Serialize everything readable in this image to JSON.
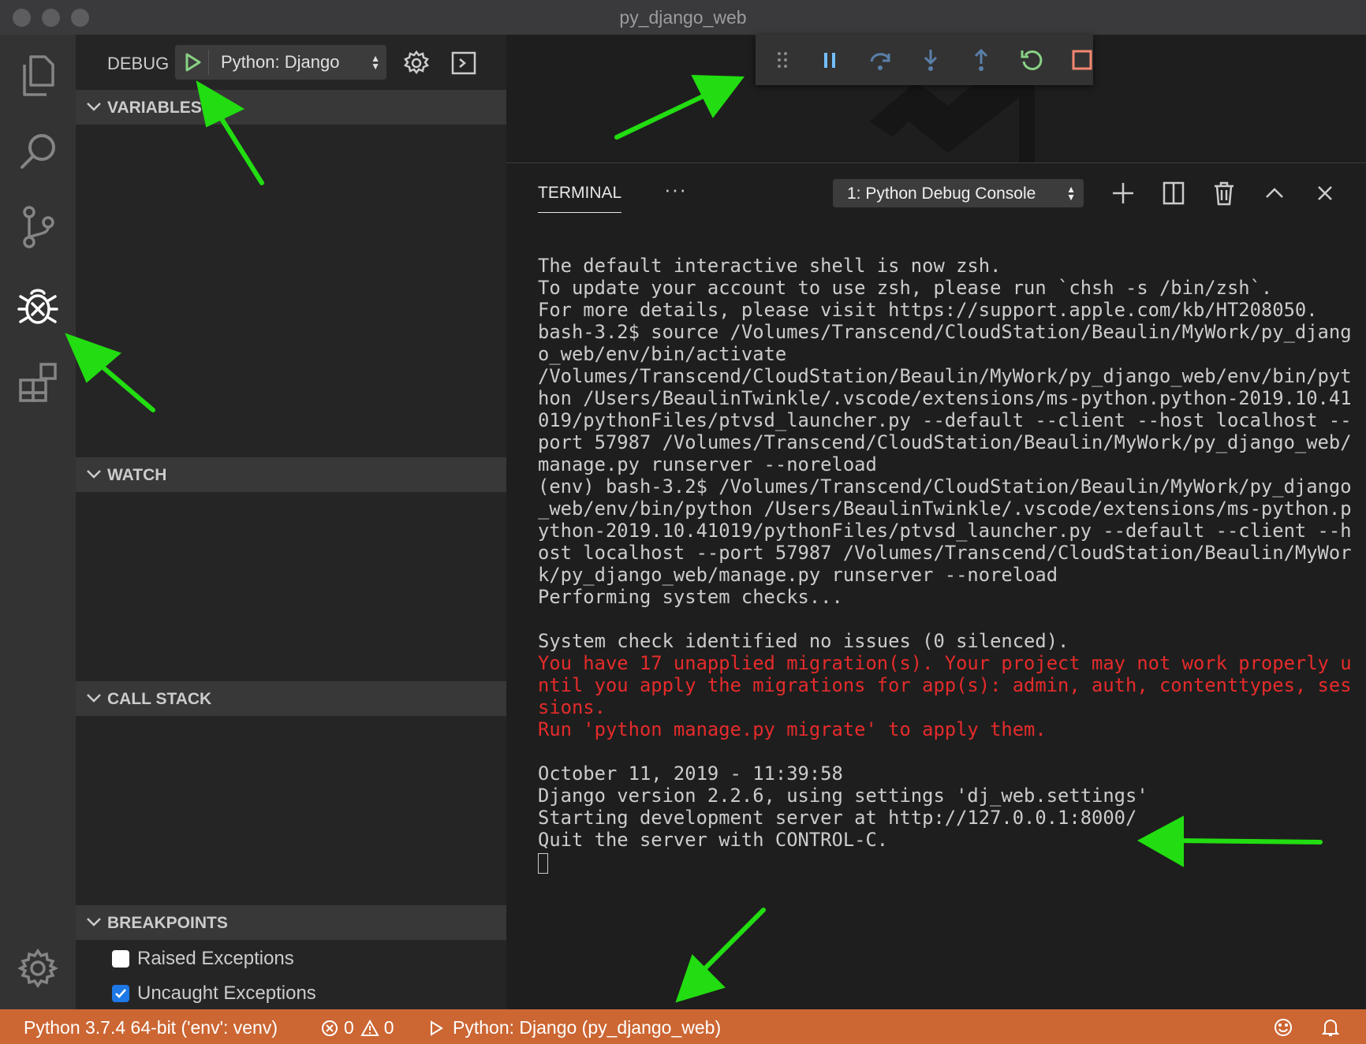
{
  "window": {
    "title": "py_django_web"
  },
  "activity_bar": {
    "items": [
      {
        "name": "explorer-icon"
      },
      {
        "name": "search-icon"
      },
      {
        "name": "source-control-icon"
      },
      {
        "name": "debug-icon",
        "active": true
      },
      {
        "name": "extensions-icon"
      }
    ],
    "bottom": {
      "name": "gear-icon"
    }
  },
  "debug_toolbar": {
    "label": "DEBUG",
    "configuration": "Python: Django",
    "icons": [
      "start-debugging-icon",
      "settings-gear-icon",
      "debug-console-icon"
    ]
  },
  "sections": [
    {
      "title": "VARIABLES"
    },
    {
      "title": "WATCH"
    },
    {
      "title": "CALL STACK"
    },
    {
      "title": "BREAKPOINTS"
    }
  ],
  "breakpoints": [
    {
      "label": "Raised Exceptions",
      "checked": false
    },
    {
      "label": "Uncaught Exceptions",
      "checked": true
    }
  ],
  "floating_debug_controls": [
    "drag-handle-icon",
    "pause-icon",
    "step-over-icon",
    "step-into-icon",
    "step-out-icon",
    "restart-icon",
    "stop-icon"
  ],
  "panel": {
    "active_tab": "TERMINAL",
    "more": "···",
    "terminal_select": "1: Python Debug Console",
    "icons": [
      "new-terminal-icon",
      "split-terminal-icon",
      "kill-terminal-icon",
      "maximize-panel-icon",
      "close-panel-icon"
    ]
  },
  "terminal": {
    "block1": "The default interactive shell is now zsh.\nTo update your account to use zsh, please run `chsh -s /bin/zsh`.\nFor more details, please visit https://support.apple.com/kb/HT208050.\nbash-3.2$ source /Volumes/Transcend/CloudStation/Beaulin/MyWork/py_djang\no_web/env/bin/activate\n/Volumes/Transcend/CloudStation/Beaulin/MyWork/py_django_web/env/bin/pyt\nhon /Users/BeaulinTwinkle/.vscode/extensions/ms-python.python-2019.10.41\n019/pythonFiles/ptvsd_launcher.py --default --client --host localhost --\nport 57987 /Volumes/Transcend/CloudStation/Beaulin/MyWork/py_django_web/\nmanage.py runserver --noreload\n(env) bash-3.2$ /Volumes/Transcend/CloudStation/Beaulin/MyWork/py_django\n_web/env/bin/python /Users/BeaulinTwinkle/.vscode/extensions/ms-python.p\nython-2019.10.41019/pythonFiles/ptvsd_launcher.py --default --client --h\nost localhost --port 57987 /Volumes/Transcend/CloudStation/Beaulin/MyWor\nk/py_django_web/manage.py runserver --noreload\nPerforming system checks...\n\nSystem check identified no issues (0 silenced).\n",
    "warning": "You have 17 unapplied migration(s). Your project may not work properly u\nntil you apply the migrations for app(s): admin, auth, contenttypes, ses\nsions.\nRun 'python manage.py migrate' to apply them.",
    "block2": "\n\nOctober 11, 2019 - 11:39:58\nDjango version 2.2.6, using settings 'dj_web.settings'\nStarting development server at http://127.0.0.1:8000/\nQuit the server with CONTROL-C.\n"
  },
  "status_bar": {
    "interpreter": "Python 3.7.4 64-bit ('env': venv)",
    "errors": "0",
    "warnings": "0",
    "debug_session": "Python: Django (py_django_web)",
    "icons": [
      "error-icon",
      "warning-icon",
      "play-icon",
      "feedback-smiley-icon",
      "notifications-bell-icon"
    ]
  },
  "colors": {
    "status_bar": "#cc6633",
    "annotation_arrow": "#22dd11",
    "terminal_error_text": "#e52b2b",
    "debug_green": "#89d185",
    "stop_red": "#f48771"
  },
  "annotations": {
    "arrow_count": 5
  }
}
